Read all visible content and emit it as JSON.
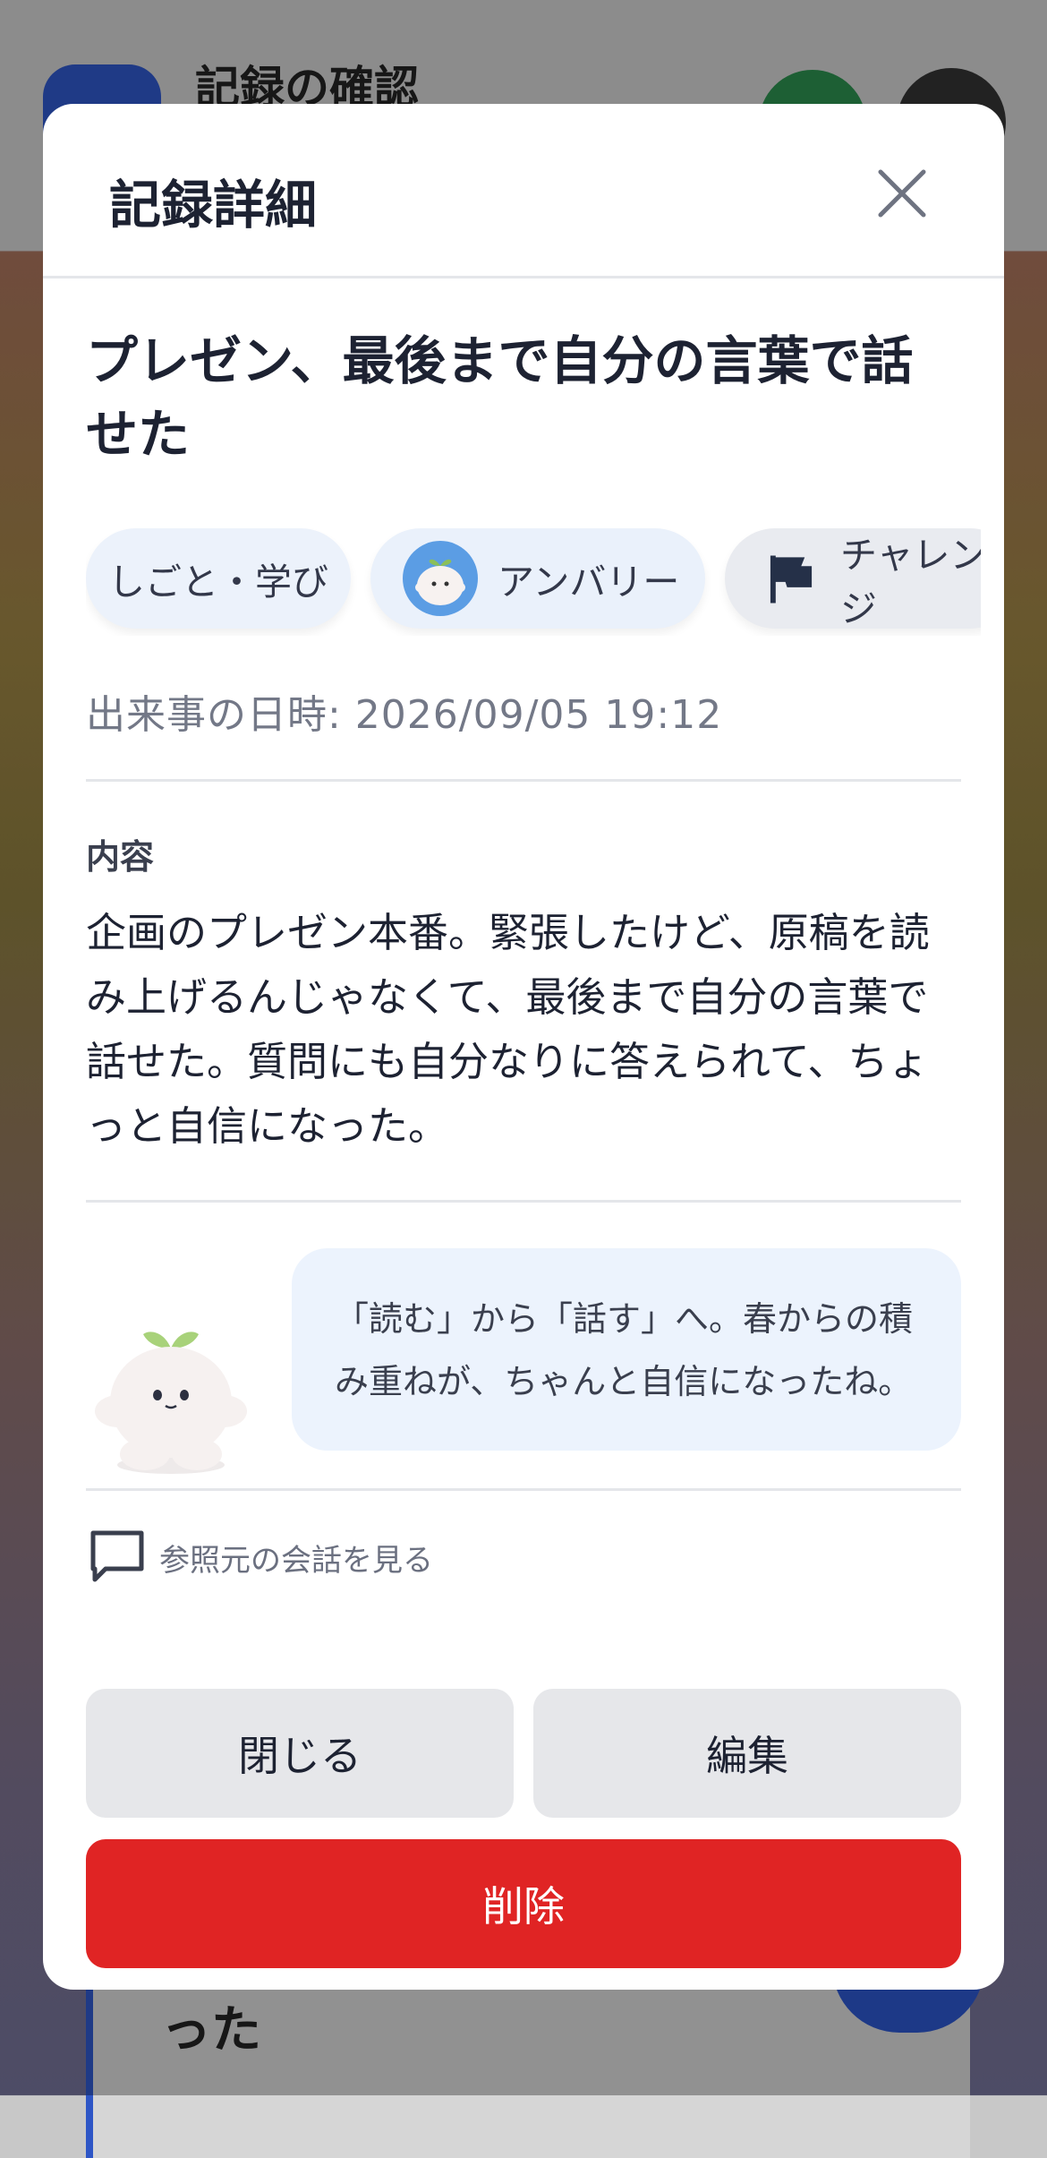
{
  "background": {
    "header_title": "記録の確認",
    "card_text": "った"
  },
  "modal": {
    "title": "記録詳細",
    "close_icon": "close-icon"
  },
  "record": {
    "title": "プレゼン、最後まで自分の言葉で話せた",
    "tags": [
      {
        "label": "しごと・学び",
        "icon": null
      },
      {
        "label": "アンバリー",
        "icon": "character-avatar-icon"
      },
      {
        "label": "チャレンジ",
        "icon": "flag-icon"
      }
    ],
    "datetime_label": "出来事の日時: 2026/09/05 19:12",
    "content_label": "内容",
    "content": "企画のプレゼン本番。緊張したけど、原稿を読み上げるんじゃなくて、最後まで自分の言葉で話せた。質問にも自分なりに答えられて、ちょっと自信になった。",
    "comment": "「読む」から「話す」へ。春からの積み重ねが、ちゃんと自信になったね。",
    "ref_link": "参照元の会話を見る"
  },
  "buttons": {
    "close": "閉じる",
    "edit": "編集",
    "delete": "削除"
  },
  "colors": {
    "accent": "#2e56c6",
    "danger": "#e02424",
    "bubble": "#ecf3fd"
  }
}
